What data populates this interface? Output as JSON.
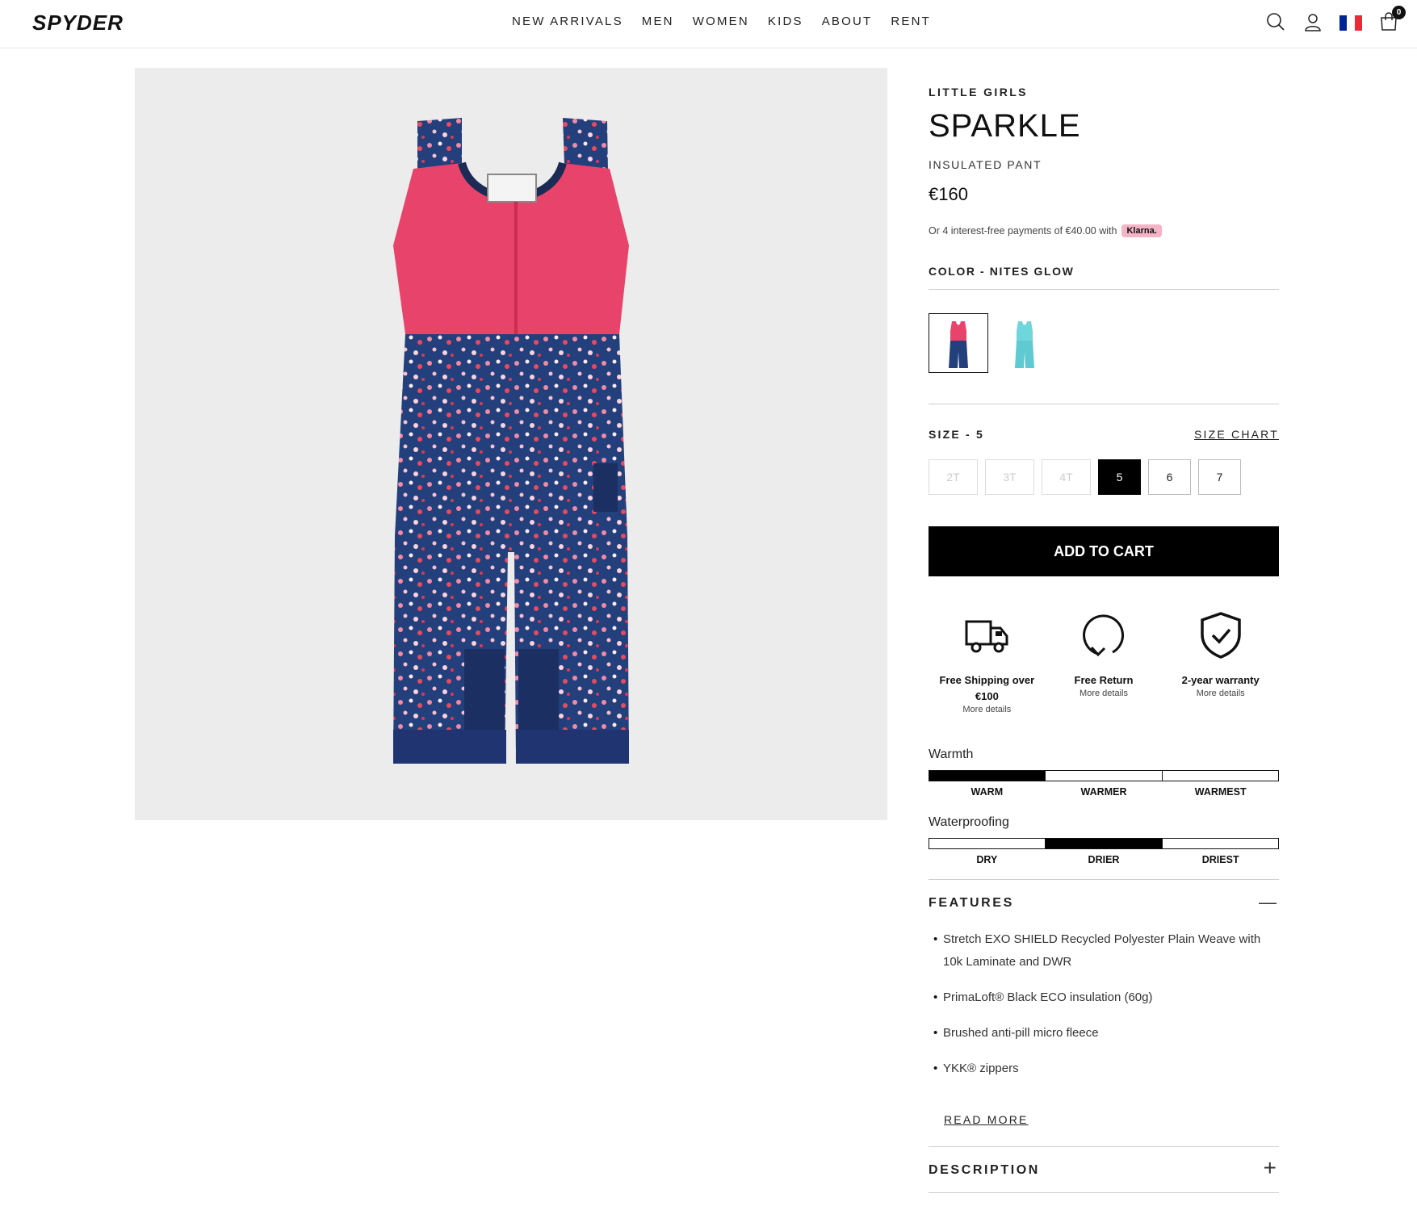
{
  "brand": {
    "logo_text": "SPYDER"
  },
  "nav": [
    "NEW ARRIVALS",
    "MEN",
    "WOMEN",
    "KIDS",
    "ABOUT",
    "RENT"
  ],
  "header": {
    "cart_count": "0",
    "flag_colors": [
      "#002395",
      "#ffffff",
      "#ed2939"
    ]
  },
  "product": {
    "category": "LITTLE GIRLS",
    "name": "SPARKLE",
    "subtitle": "INSULATED PANT",
    "price": "€160",
    "klarna_text": "Or 4 interest-free payments of €40.00 with",
    "klarna_badge": "Klarna.",
    "color_label": "COLOR - NITES GLOW",
    "swatch_colors": [
      "#e8436a",
      "#6fd6dc"
    ],
    "size_label": "SIZE - 5",
    "size_chart": "SIZE CHART",
    "sizes": [
      {
        "label": "2T",
        "state": "disabled"
      },
      {
        "label": "3T",
        "state": "disabled"
      },
      {
        "label": "4T",
        "state": "disabled"
      },
      {
        "label": "5",
        "state": "selected"
      },
      {
        "label": "6",
        "state": "available"
      },
      {
        "label": "7",
        "state": "available"
      }
    ],
    "add_to_cart": "ADD TO CART"
  },
  "perks": [
    {
      "icon": "truck-icon",
      "title_line1": "Free Shipping over",
      "title_line2": "€100",
      "detail": "More details"
    },
    {
      "icon": "return-arrow-icon",
      "title_line1": "Free Return",
      "title_line2": "",
      "detail": "More details"
    },
    {
      "icon": "shield-check-icon",
      "title_line1": "2-year warranty",
      "title_line2": "",
      "detail": "More details"
    }
  ],
  "ratings": [
    {
      "label": "Warmth",
      "levels": [
        "WARM",
        "WARMER",
        "WARMEST"
      ],
      "value": 1
    },
    {
      "label": "Waterproofing",
      "levels": [
        "DRY",
        "DRIER",
        "DRIEST"
      ],
      "value": 2
    }
  ],
  "features": {
    "title": "FEATURES",
    "toggle": "—",
    "items": [
      "Stretch EXO SHIELD Recycled Polyester Plain Weave with 10k Laminate and DWR",
      "PrimaLoft® Black ECO insulation (60g)",
      "Brushed anti-pill micro fleece",
      "YKK® zippers"
    ],
    "read_more": "READ MORE"
  },
  "description": {
    "title": "DESCRIPTION",
    "toggle": "+"
  }
}
